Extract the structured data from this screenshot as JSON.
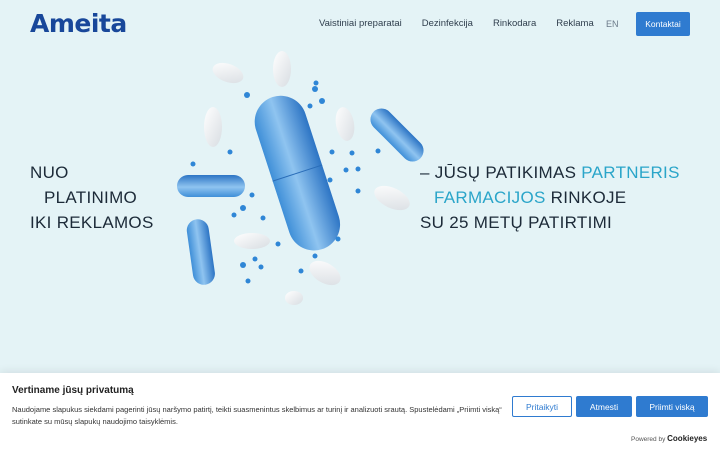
{
  "brand": {
    "logo": "Ameita"
  },
  "nav": {
    "items": [
      "Vaistiniai preparatai",
      "Dezinfekcija",
      "Rinkodara",
      "Reklama"
    ],
    "lang": "EN",
    "contact": "Kontaktai"
  },
  "hero": {
    "left": [
      "NUO",
      "PLATINIMO",
      "IKI REKLAMOS"
    ],
    "right": {
      "line1_plain": "– JŪSŲ PATIKIMAS ",
      "line1_accent": "PARTNERIS",
      "line2_accent": "FARMACIJOS",
      "line2_plain": " RINKOJE",
      "line3": "SU 25 METŲ PATIRTIMI"
    }
  },
  "cookie": {
    "title": "Vertiname jūsų privatumą",
    "text": "Naudojame slapukus siekdami pagerinti jūsų naršymo patirtį, teikti suasmenintus skelbimus ar turinį ir analizuoti srautą. Spustelėdami „Priimti viską“ sutinkate su mūsų slapukų naudojimo taisyklėmis.",
    "customize": "Pritaikyti",
    "reject": "Atmesti",
    "accept": "Priimti viską",
    "powered_prefix": "Powered by",
    "powered_brand": "Cookieyes"
  },
  "colors": {
    "accent": "#2aa5c9",
    "button": "#2f7bd0",
    "logo": "#18479a",
    "background": "#e4f3f6"
  }
}
